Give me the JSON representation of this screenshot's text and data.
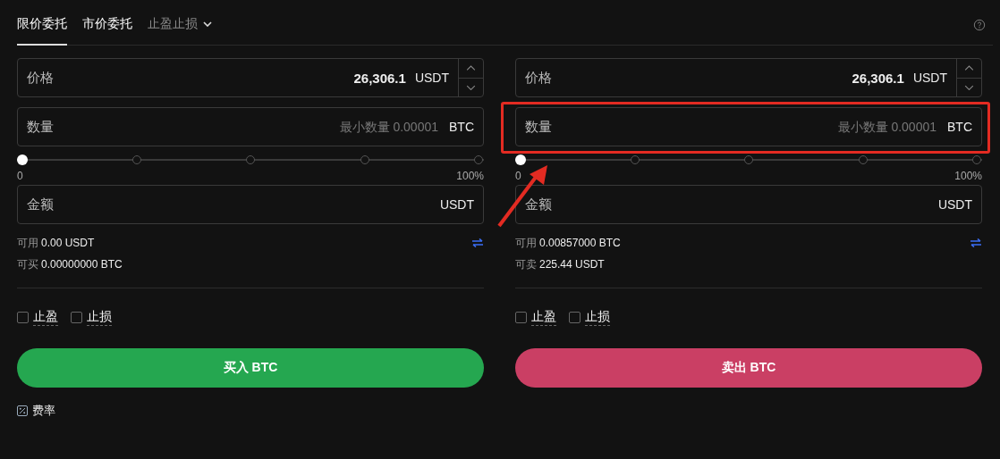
{
  "tabs": [
    {
      "label": "限价委托",
      "selected": true,
      "kind": "tab"
    },
    {
      "label": "市价委托",
      "selected": false,
      "kind": "tab"
    },
    {
      "label": "止盈止损",
      "selected": false,
      "kind": "dropdown"
    }
  ],
  "panels": [
    {
      "price": {
        "label": "价格",
        "value": "26,306.1",
        "unit": "USDT"
      },
      "quantity": {
        "label": "数量",
        "placeholder": "最小数量 0.00001",
        "unit": "BTC"
      },
      "slider": {
        "level": 0,
        "min_label": "0",
        "max_label": "100%"
      },
      "amount": {
        "label": "金额",
        "unit": "USDT"
      },
      "balances": [
        {
          "label": "可用",
          "value": "0.00 USDT"
        },
        {
          "label": "可买",
          "value": "0.00000000 BTC"
        }
      ],
      "checkboxes": [
        {
          "label": "止盈",
          "checked": false
        },
        {
          "label": "止损",
          "checked": false
        }
      ],
      "button": {
        "label": "买入 BTC",
        "kind": "buy"
      }
    },
    {
      "price": {
        "label": "价格",
        "value": "26,306.1",
        "unit": "USDT"
      },
      "quantity": {
        "label": "数量",
        "placeholder": "最小数量 0.00001",
        "unit": "BTC"
      },
      "slider": {
        "level": 0,
        "min_label": "0",
        "max_label": "100%"
      },
      "amount": {
        "label": "金额",
        "unit": "USDT"
      },
      "balances": [
        {
          "label": "可用",
          "value": "0.00857000 BTC"
        },
        {
          "label": "可卖",
          "value": "225.44 USDT"
        }
      ],
      "checkboxes": [
        {
          "label": "止盈",
          "checked": false
        },
        {
          "label": "止损",
          "checked": false
        }
      ],
      "button": {
        "label": "卖出 BTC",
        "kind": "sell"
      },
      "highlighted": true
    }
  ],
  "fee_link": "费率"
}
